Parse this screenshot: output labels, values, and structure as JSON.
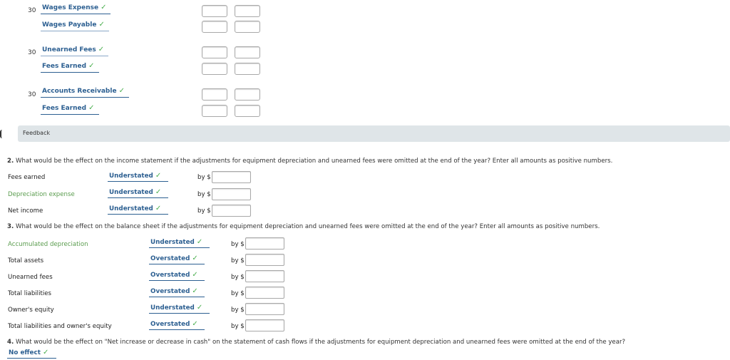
{
  "journal": {
    "entries": [
      {
        "day": "30",
        "debit": "Wages Expense",
        "credit": "Wages Payable"
      },
      {
        "day": "30",
        "debit": "Unearned Fees",
        "credit": "Fees Earned"
      },
      {
        "day": "30",
        "debit": "Accounts Receivable",
        "credit": "Fees Earned"
      }
    ],
    "check_glyph": "✓"
  },
  "feedback": {
    "label": "Feedback"
  },
  "q2": {
    "number": "2.",
    "text": " What would be the effect on the income statement if the adjustments for equipment depreciation and unearned fees were omitted at the end of the year? Enter all amounts as positive numbers.",
    "rows": [
      {
        "label": "Fees earned",
        "label_color": "default",
        "answer": "Understated",
        "by": "by $",
        "amount": ""
      },
      {
        "label": "Depreciation expense",
        "label_color": "green",
        "answer": "Understated",
        "by": "by $",
        "amount": ""
      },
      {
        "label": "Net income",
        "label_color": "default",
        "answer": "Understated",
        "by": "by $",
        "amount": ""
      }
    ]
  },
  "q3": {
    "number": "3.",
    "text": " What would be the effect on the balance sheet if the adjustments for equipment depreciation and unearned fees were omitted at the end of the year? Enter all amounts as positive numbers.",
    "rows": [
      {
        "label": "Accumulated depreciation",
        "label_color": "green",
        "answer": "Understated",
        "by": "by $",
        "amount": ""
      },
      {
        "label": "Total assets",
        "label_color": "default",
        "answer": "Overstated",
        "by": "by $",
        "amount": ""
      },
      {
        "label": "Unearned fees",
        "label_color": "default",
        "answer": "Overstated",
        "by": "by $",
        "amount": ""
      },
      {
        "label": "Total liabilities",
        "label_color": "default",
        "answer": "Overstated",
        "by": "by $",
        "amount": ""
      },
      {
        "label": "Owner's equity",
        "label_color": "default",
        "answer": "Understated",
        "by": "by $",
        "amount": ""
      },
      {
        "label": "Total liabilities and owner's equity",
        "label_color": "default",
        "answer": "Overstated",
        "by": "by $",
        "amount": ""
      }
    ]
  },
  "q4": {
    "number": "4.",
    "text": " What would be the effect on \"Net increase or decrease in cash\" on the statement of cash flows if the adjustments for equipment depreciation and unearned fees were omitted at the end of the year?",
    "answer": "No effect"
  },
  "colors": {
    "answer_blue": "#2c5f91",
    "check_green": "#4caf50",
    "label_green": "#5a9c4e",
    "feedback_bg": "#dfe5e8"
  }
}
